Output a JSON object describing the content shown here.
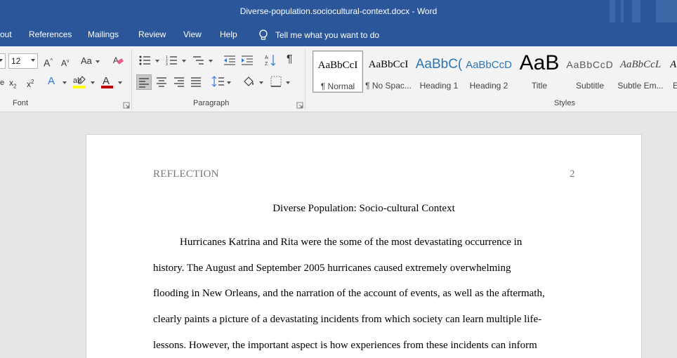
{
  "window": {
    "title": "Diverse-population.sociocultural-context.docx  -  Word"
  },
  "menu": {
    "tabs": [
      "out",
      "References",
      "Mailings",
      "Review",
      "View",
      "Help"
    ],
    "tell_me": "Tell me what you want to do"
  },
  "ribbon": {
    "font": {
      "label": "Font",
      "size_value": "12"
    },
    "paragraph": {
      "label": "Paragraph"
    },
    "styles": {
      "label": "Styles",
      "items": [
        {
          "preview": "AaBbCcI",
          "name": "¶ Normal"
        },
        {
          "preview": "AaBbCcI",
          "name": "¶ No Spac..."
        },
        {
          "preview": "AaBbC(",
          "name": "Heading 1"
        },
        {
          "preview": "AaBbCcD",
          "name": "Heading 2"
        },
        {
          "preview": "AaB",
          "name": "Title"
        },
        {
          "preview": "AaBbCcD",
          "name": "Subtitle"
        },
        {
          "preview": "AaBbCcL",
          "name": "Subtle Em..."
        },
        {
          "preview": "A",
          "name": "E"
        }
      ]
    }
  },
  "document": {
    "header_left": "REFLECTION",
    "page_number": "2",
    "title": "Diverse Population: Socio-cultural Context",
    "lines": [
      "Hurricanes Katrina and Rita were the some of the most devastating occurrence in",
      "history. The August and September 2005 hurricanes caused extremely overwhelming",
      "flooding in New Orleans, and the narration of the account of events, as well as the aftermath,",
      "clearly paints a picture of a devastating incidents from which society can learn multiple life-",
      "lessons. However, the important aspect is how experiences from these incidents can inform"
    ]
  },
  "colors": {
    "title_bar": "#2b579a",
    "ribbon_bg": "#f3f3f3",
    "font_color_red": "#c00000",
    "highlight_yellow": "#ffff00",
    "text_effects_blue": "#2e75d6"
  }
}
